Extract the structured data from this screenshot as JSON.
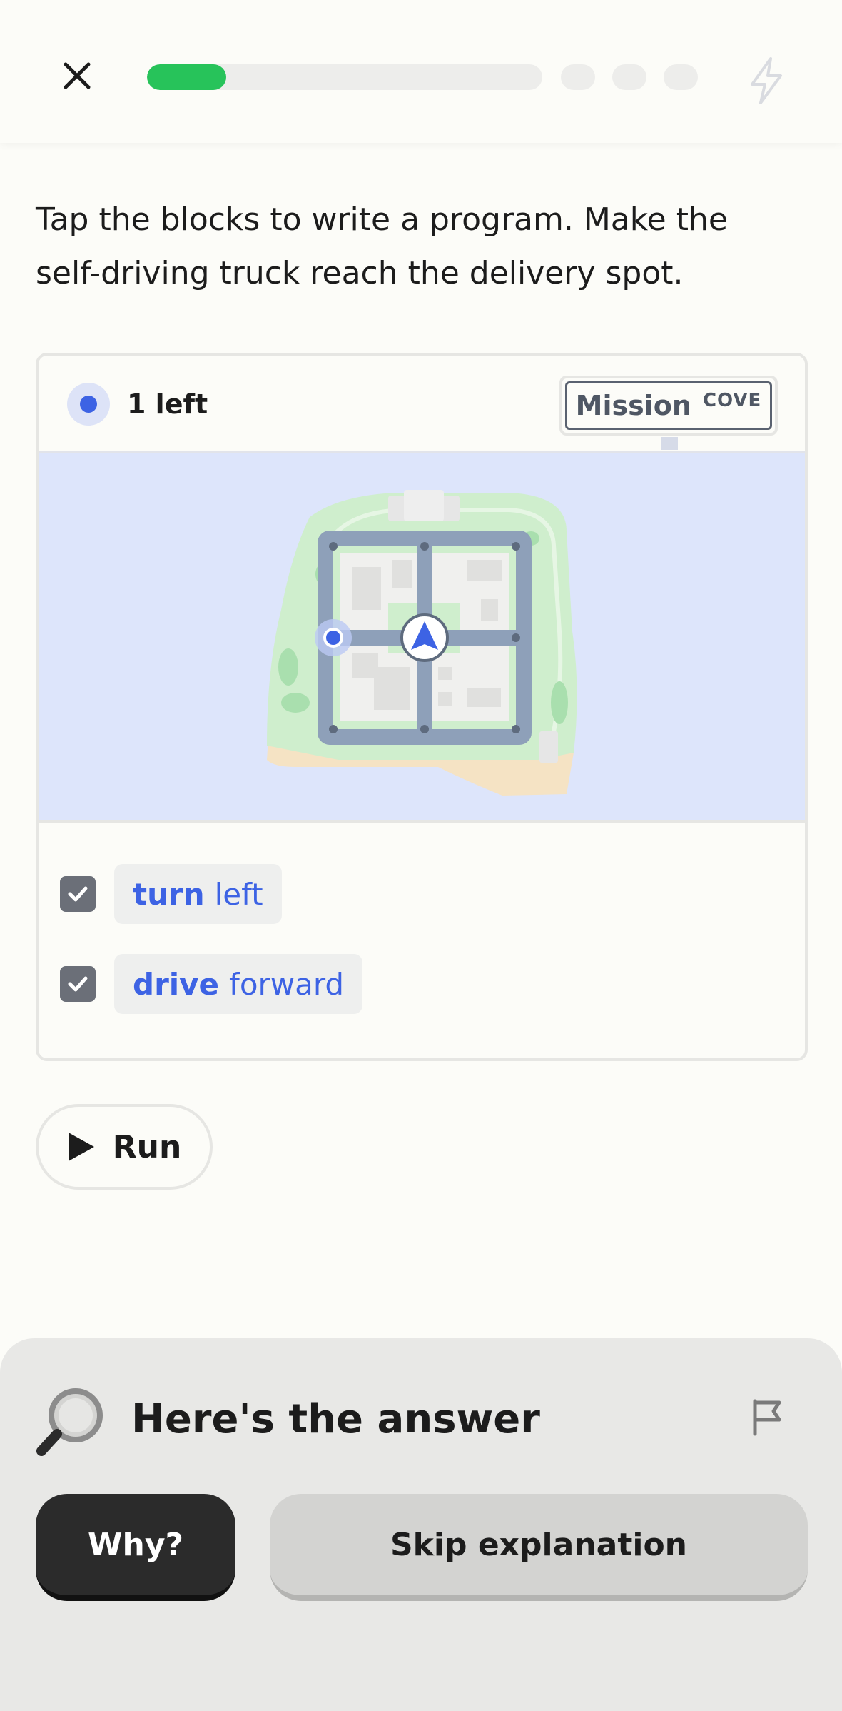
{
  "header": {
    "close_icon": "close-icon",
    "progress_fraction": 0.2,
    "progress_color": "#27c35a",
    "remaining_steps": 3,
    "streak_icon": "bolt-icon"
  },
  "prompt": {
    "line1": "Tap the blocks to write a program. Make the",
    "line2": "self-driving truck reach the delivery spot."
  },
  "puzzle": {
    "moves_left_label": "1 left",
    "mission_badge": {
      "word": "Mission",
      "sub": "COVE"
    },
    "map": {
      "water_color": "#dde5fb",
      "truck_icon": "navigation-arrow-icon",
      "destination_icon": "destination-dot-icon"
    },
    "blocks": [
      {
        "keyword": "turn",
        "argument": "left",
        "checked": true
      },
      {
        "keyword": "drive",
        "argument": "forward",
        "checked": true
      }
    ]
  },
  "run_button": {
    "label": "Run",
    "icon": "play-icon"
  },
  "answer_sheet": {
    "title": "Here's the answer",
    "icon": "magnifier-icon",
    "report_icon": "flag-icon",
    "why_label": "Why?",
    "skip_label": "Skip explanation"
  },
  "colors": {
    "accent_blue": "#3d63e4",
    "dark_button": "#2b2b2b"
  }
}
